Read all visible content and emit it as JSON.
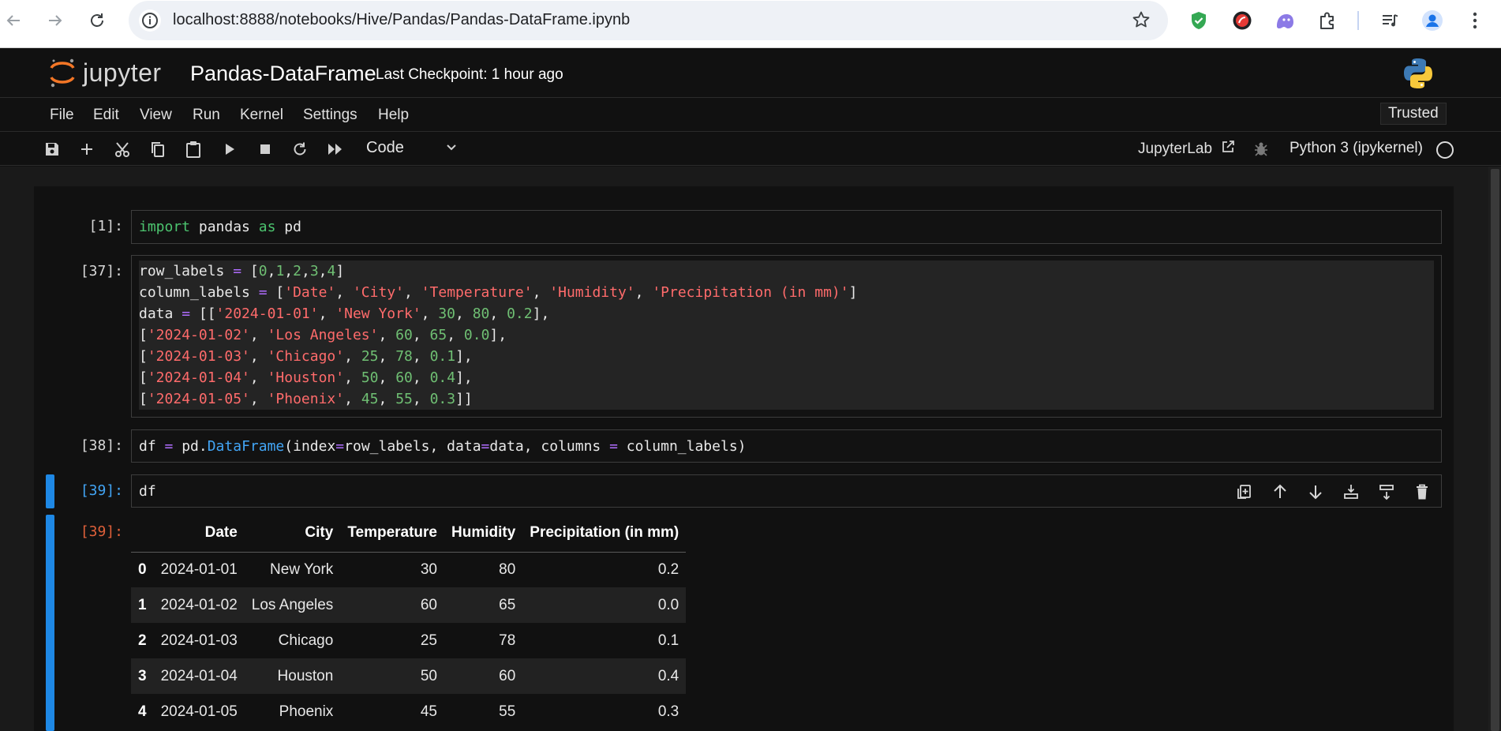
{
  "browser": {
    "url": "localhost:8888/notebooks/Hive/Pandas/Pandas-DataFrame.ipynb"
  },
  "header": {
    "logo_text": "jupyter",
    "notebook_title": "Pandas-DataFrame",
    "checkpoint": "Last Checkpoint: 1 hour ago"
  },
  "menu": {
    "items": [
      "File",
      "Edit",
      "View",
      "Run",
      "Kernel",
      "Settings",
      "Help"
    ],
    "trusted": "Trusted"
  },
  "toolbar": {
    "cell_type": "Code",
    "jupyterlab": "JupyterLab",
    "kernel": "Python 3 (ipykernel)"
  },
  "cells": [
    {
      "prompt": "[1]:"
    },
    {
      "prompt": "[37]:"
    },
    {
      "prompt": "[38]:"
    },
    {
      "prompt": "[39]:",
      "code": "df"
    },
    {
      "output_prompt": "[39]:"
    }
  ],
  "dataframe": {
    "columns": [
      "",
      "Date",
      "City",
      "Temperature",
      "Humidity",
      "Precipitation (in mm)"
    ],
    "rows": [
      [
        "0",
        "2024-01-01",
        "New York",
        "30",
        "80",
        "0.2"
      ],
      [
        "1",
        "2024-01-02",
        "Los Angeles",
        "60",
        "65",
        "0.0"
      ],
      [
        "2",
        "2024-01-03",
        "Chicago",
        "25",
        "78",
        "0.1"
      ],
      [
        "3",
        "2024-01-04",
        "Houston",
        "50",
        "60",
        "0.4"
      ],
      [
        "4",
        "2024-01-05",
        "Phoenix",
        "45",
        "55",
        "0.3"
      ]
    ]
  },
  "colors": {
    "accent_blue": "#1e88e5",
    "keyword_green": "#4cc46f",
    "string_red": "#ff6b6b",
    "operator_purple": "#b06dff",
    "output_prompt": "#e0603a"
  }
}
